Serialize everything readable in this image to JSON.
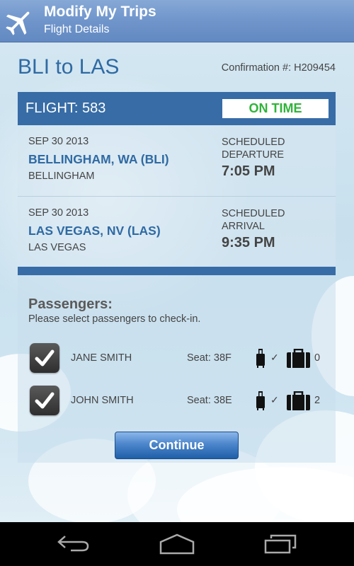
{
  "header": {
    "title": "Modify My Trips",
    "subtitle": "Flight Details",
    "icon": "airplane-icon",
    "color": "#6f95cb"
  },
  "trip": {
    "route": "BLI to LAS",
    "confirmation": "Confirmation #: H209454"
  },
  "flight": {
    "number_label": "FLIGHT: 583",
    "status": "ON TIME",
    "status_color": "#2fb43a",
    "bar_color": "#376ca6"
  },
  "segments": [
    {
      "date": "SEP 30 2013",
      "city": "BELLINGHAM, WA (BLI)",
      "sub": "BELLINGHAM",
      "label_line1": "SCHEDULED",
      "label_line2": "DEPARTURE",
      "time": "7:05 PM"
    },
    {
      "date": "SEP 30 2013",
      "city": "LAS VEGAS, NV (LAS)",
      "sub": "LAS VEGAS",
      "label_line1": "SCHEDULED",
      "label_line2": "ARRIVAL",
      "time": "9:35 PM"
    }
  ],
  "passengers": {
    "title": "Passengers:",
    "hint": "Please select passengers to check-in.",
    "list": [
      {
        "name": "JANE SMITH",
        "seat": "Seat: 38F",
        "checked": true,
        "carry_on_check": "✓",
        "bags": "0"
      },
      {
        "name": "JOHN SMITH",
        "seat": "Seat: 38E",
        "checked": true,
        "carry_on_check": "✓",
        "bags": "2"
      }
    ],
    "continue_label": "Continue"
  },
  "navbar": {
    "buttons": [
      "back-icon",
      "home-icon",
      "recent-apps-icon"
    ]
  }
}
